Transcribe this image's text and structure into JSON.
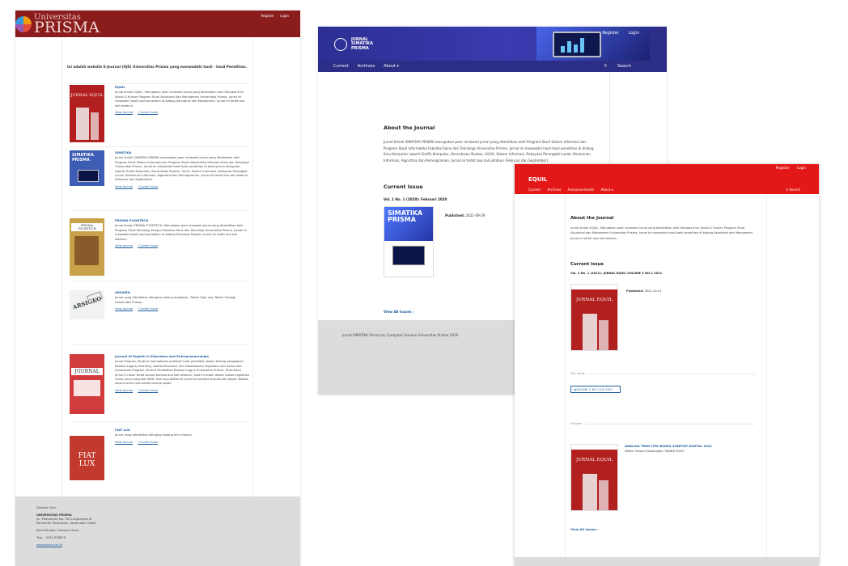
{
  "portal": {
    "logo_line1": "Universitas",
    "logo_line2": "PRISMA",
    "register": "Register",
    "login": "Login",
    "intro": "Ini adalah website E-Journal (OJS) Universitas Prisma yang menwadahi hasil - hasil Penelitian.",
    "view_journal": "View Journal",
    "current_issue": "Current Issue",
    "journals": [
      {
        "title": "EQUIL",
        "desc": "Jurnal Ilmiah EQUIL. Merupakan peer reviewed jurnal yang diterbitkan oleh Fakultas Ilmu Sosial & Hukum Program Studi Akuntansi dan Manajemen Universitas Prisma. Jurnal ini mewadahi hasil-hasil penelitian di bidang Akuntansi dan Manajemen. Jurnal ini terbit dua kali setahun.",
        "cover_text": "JURNAL EQUIL"
      },
      {
        "title": "SIMATIKA",
        "desc": "Jurnal Ilmiah SIMATIKA PRISMA merupakan peer reviewed jurnal yang diterbitkan oleh Program Studi Sistem Informasi dan Program Studi Informatika Fakultas Sains dan Teknologi Universitas Prisma. Jurnal ini mewadahi hasil-hasil penelitian di bidang Ilmu Komputer seperti Grafik Komputer, Kecerdasan Buatan, UI/UX, Sistem Informasi, Rekayasa Perangkat Lunak, Keamanan Informasi, Algoritma dan Pemrograman. Jurnal ini terbit dua kali setahun (Februari dan September)",
        "cover_text": "SIMATIKA PRISMA"
      },
      {
        "title": "PRISMA FOODTECH",
        "desc": "Jurnal Ilmiah PRISMA FOODTECH. Merupakan peer reviewed jurnal yang diterbitkan oleh Program Studi Teknologi Pangan Fakultas Sains dan Teknologi Universitas Prisma. Jurnal ini mewadahi hasil-hasil penelitian di bidang Teknologi Pangan. Jurnal ini terbit dua kali setahun.",
        "cover_text": "PRISMA FOODTECH"
      },
      {
        "title": "ARSIGEO",
        "desc": "Jurnal yang diterbitkan dilingkup bidang Arsitektur, Teknik Sipil, dan Teknik Geologi Universitas Prisma.",
        "cover_text": "ARSIGEO"
      },
      {
        "title": "Journal of English in Education and Entrepreneurships",
        "desc": "Jurnal Program Studi ini memadukan publikasi hasil penelitian dalam bidang pengajaran Bahasa Inggris/ teaching, sastra/ literature, dan kebahasaan/ linguistics dan dosen dan mahasiswa Program Studi di Pendidikan Bahasa Inggris Universitas Prisma. Penerbitan jurnal ini akan terbit secara berkala dua kali setahun. Saat ini masih dalam proses registrasi untuk jurnal yang ber-ISSN. Semua publikasi di jurnal ini bersifat terbuka dan dapat diakses secara online dan dalam bentuk paper.",
        "cover_text": "JOURNAL"
      },
      {
        "title": "FIAT LUX",
        "desc": "Jurnal yang diterbitkan dilingkup bidang Ilmu Hukum",
        "cover_text": "FIAT LUX"
      }
    ],
    "footer": {
      "label": "Dikelola Oleh:",
      "org": "UNIVERSITAS PRISMA",
      "addr1": "Jln. Pomdaman No. 152 Lingkungan III,",
      "addr2": "Kelurahan Tikala Baru, Kecamatan Tikala",
      "city": "Kota Manado, Sulawesi Utara",
      "phone": "Telp. : 0431-858878",
      "web": "www.prisma.ac.id"
    }
  },
  "simatika": {
    "logo_line1": "JURNAL",
    "logo_line2": "SIMATIKA",
    "logo_line3": "PRISMA",
    "register": "Register",
    "login": "Login",
    "nav": [
      "Current",
      "Archives",
      "About ▾"
    ],
    "search": "Search",
    "about_heading": "About the Journal",
    "about_text": "Jurnal Ilmiah SIMATIKA PRISMA  merupakan peer reviewed jurnal yang diterbitkan oleh Program Studi Sistem Informasi dan Program Studi Informatika Fakultas Sains dan Teknologi Universitas Prisma. Jurnal ini mewadahi hasil-hasil penelitian di bidang Ilmu Komputer seperti Grafik Komputer, Kecerdasan Buatan, UI/UX, Sistem Informasi, Rekayasa Perangkat Lunak, Keamanan Informasi, Algoritma dan Pemrograman. Jurnal ini terbit dua kali setahun (Februari dan September)",
    "current_heading": "Current Issue",
    "issue_title": "Vol. 1 No. 1 (2020): Februari 2020",
    "cover_text": "SIMATIKA PRISMA",
    "published_label": "Published:",
    "published_date": "2021-09-29",
    "view_all": "View All Issues",
    "footer": "Jurnal SIMATIKA Prisma by Computer Science Universitas Prisma 2019"
  },
  "equil": {
    "register": "Register",
    "login": "Login",
    "title": "EQUIL",
    "nav": [
      "Current",
      "Archives",
      "Announcements",
      "About ▾"
    ],
    "search": "Search",
    "about_heading": "About the Journal",
    "about_text": "Jurnal Ilmiah EQUIL. Merupakan peer reviewed jurnal yang diterbitkan oleh Fakultas Ilmu Sosial & Hukum Program Studi Akuntansi dan Manajemen Universitas Prisma. Jurnal ini mewadahi hasil-hasil penelitian di bidang Akuntansi dan Manajemen. Jurnal ini terbit dua kali setahun.",
    "current_heading": "Current Issue",
    "issue_title": "Vol. 3 No. 1 (2021): JURNAL EQUIL VOLUME 3 NO.1 2021",
    "published_label": "Published:",
    "published_date": "2021-10-01",
    "cover_text": "JURNAL EQUIL",
    "full_issue": "Full Issue",
    "galley": "VOLUME 3, NO.1 JULI 2021",
    "articles": "Articles",
    "article_title": "ANALISA TREN TIPE BISNIS STARTUP DIGITAL 2021",
    "article_authors": "Maikel Oswaini Kawengian; MANDY BATU",
    "view_all": "View All Issues"
  }
}
